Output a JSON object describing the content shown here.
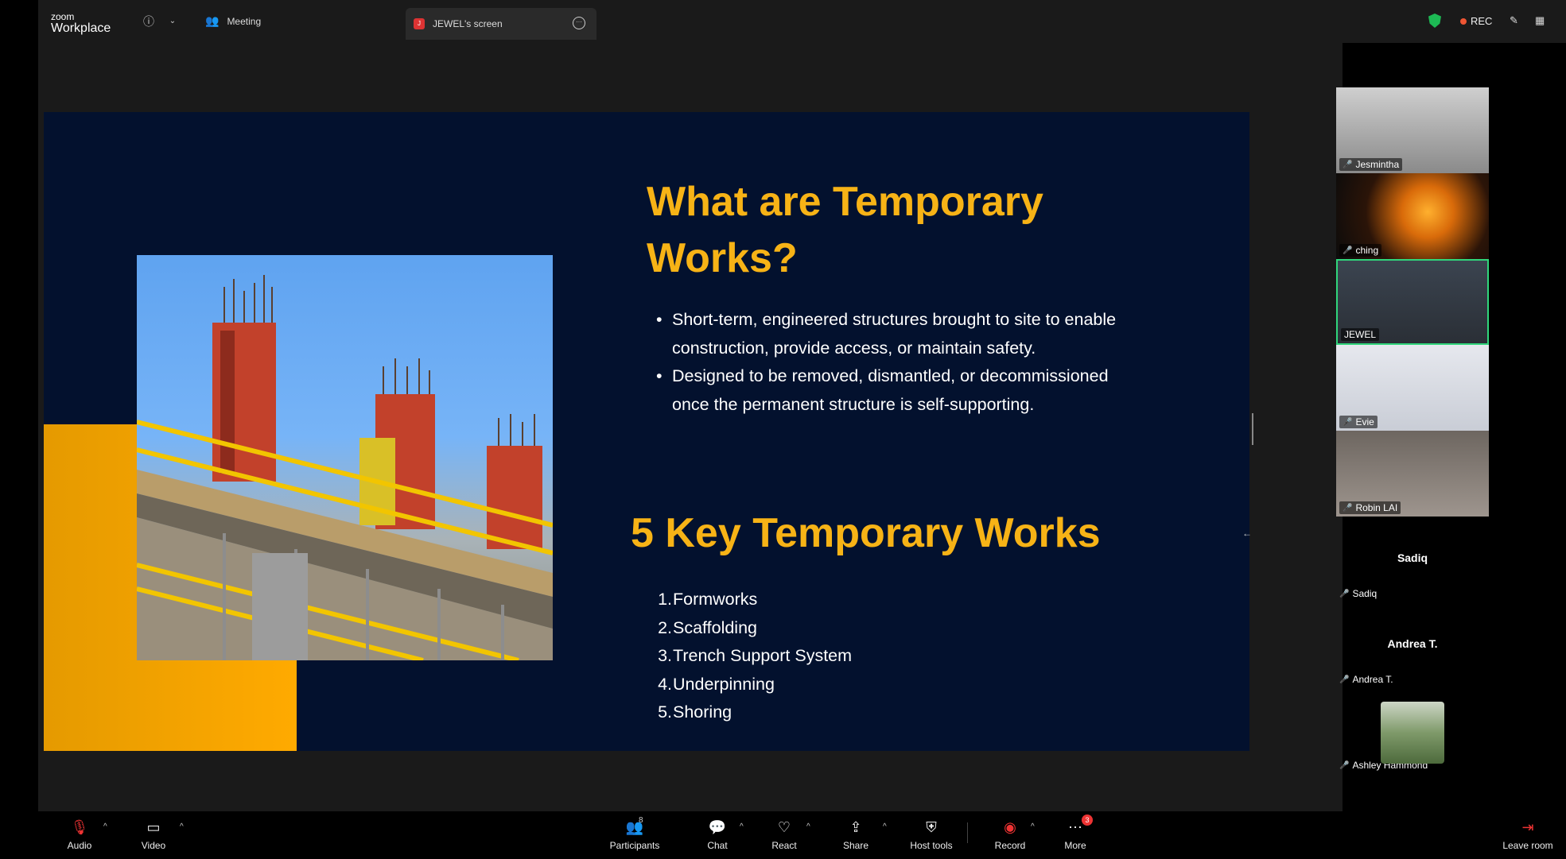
{
  "app": {
    "logo_top": "zoom",
    "logo_bottom": "Workplace"
  },
  "topbar": {
    "meeting_tab": "Meeting",
    "screen_tab": "JEWEL's screen",
    "screen_tab_initial": "J",
    "rec_label": "REC"
  },
  "slide": {
    "title": "What are Temporary Works?",
    "bullets": [
      "Short-term, engineered structures brought to site to enable construction, provide access, or maintain safety.",
      "Designed to be removed, dismantled, or decommissioned once the permanent structure is self-supporting."
    ],
    "subtitle": "5 Key Temporary Works",
    "list": [
      {
        "n": "1.",
        "text": "Formworks"
      },
      {
        "n": "2.",
        "text": "Scaffolding"
      },
      {
        "n": "3.",
        "text": "Trench Support System"
      },
      {
        "n": "4.",
        "text": "Underpinning"
      },
      {
        "n": "5.",
        "text": "Shoring"
      }
    ]
  },
  "participants": [
    {
      "name": "Jesmintha"
    },
    {
      "name": "ching"
    },
    {
      "name": "JEWEL"
    },
    {
      "name": "Evie"
    },
    {
      "name": "Robin LAI"
    },
    {
      "name": "Sadiq",
      "label": "Sadiq"
    },
    {
      "name": "Andrea T.",
      "label": "Andrea T."
    },
    {
      "name": "Ashley Hammond"
    }
  ],
  "toolbar": {
    "audio": "Audio",
    "video": "Video",
    "participants": "Participants",
    "participant_count": "8",
    "chat": "Chat",
    "react": "React",
    "share": "Share",
    "host_tools": "Host tools",
    "record": "Record",
    "more": "More",
    "more_badge": "3",
    "leave": "Leave room"
  },
  "colors": {
    "slide_bg": "#03112e",
    "accent_yellow": "#f7b316",
    "active_speaker": "#30d67b",
    "record_red": "#e53333"
  },
  "icons": [
    "info-icon",
    "chevron-down-icon",
    "participants-icon",
    "more-icon",
    "shield-icon",
    "pen-icon",
    "layout-icon",
    "mic-off-icon",
    "video-icon",
    "chat-icon",
    "heart-icon",
    "share-icon",
    "host-tools-icon",
    "record-icon",
    "leave-icon"
  ]
}
